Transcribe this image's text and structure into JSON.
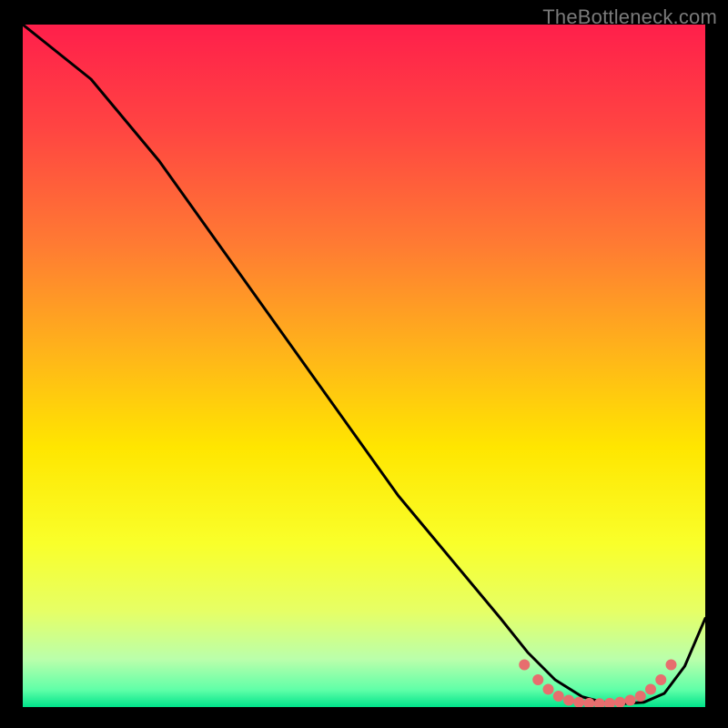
{
  "watermark": "TheBottleneck.com",
  "chart_data": {
    "type": "line",
    "title": "",
    "xlabel": "",
    "ylabel": "",
    "xlim": [
      0,
      100
    ],
    "ylim": [
      0,
      100
    ],
    "grid": false,
    "legend": false,
    "background_gradient_stops": [
      {
        "offset": 0.0,
        "color": "#ff1f4b"
      },
      {
        "offset": 0.15,
        "color": "#ff4442"
      },
      {
        "offset": 0.32,
        "color": "#ff7a33"
      },
      {
        "offset": 0.48,
        "color": "#ffb41a"
      },
      {
        "offset": 0.62,
        "color": "#ffe600"
      },
      {
        "offset": 0.76,
        "color": "#f9ff2a"
      },
      {
        "offset": 0.86,
        "color": "#e6ff66"
      },
      {
        "offset": 0.93,
        "color": "#baffab"
      },
      {
        "offset": 0.975,
        "color": "#5fffa8"
      },
      {
        "offset": 1.0,
        "color": "#00e38a"
      }
    ],
    "series": [
      {
        "name": "curve",
        "color": "#000000",
        "x": [
          0,
          5,
          10,
          15,
          20,
          25,
          30,
          35,
          40,
          45,
          50,
          55,
          60,
          65,
          70,
          74,
          78,
          82,
          85,
          88,
          91,
          94,
          97,
          100
        ],
        "y": [
          100,
          96,
          92,
          86,
          80,
          73,
          66,
          59,
          52,
          45,
          38,
          31,
          25,
          19,
          13,
          8,
          4,
          1.5,
          0.7,
          0.5,
          0.7,
          2,
          6,
          13
        ]
      }
    ],
    "markers": {
      "name": "dots",
      "color": "#e76e6e",
      "radius_px": 6,
      "x": [
        73.5,
        75.5,
        77,
        78.5,
        80,
        81.5,
        83,
        84.5,
        86,
        87.5,
        89,
        90.5,
        92,
        93.5,
        95
      ],
      "y": [
        6.2,
        4.0,
        2.6,
        1.6,
        1.0,
        0.7,
        0.55,
        0.5,
        0.55,
        0.7,
        1.0,
        1.6,
        2.6,
        4.0,
        6.2
      ]
    }
  }
}
